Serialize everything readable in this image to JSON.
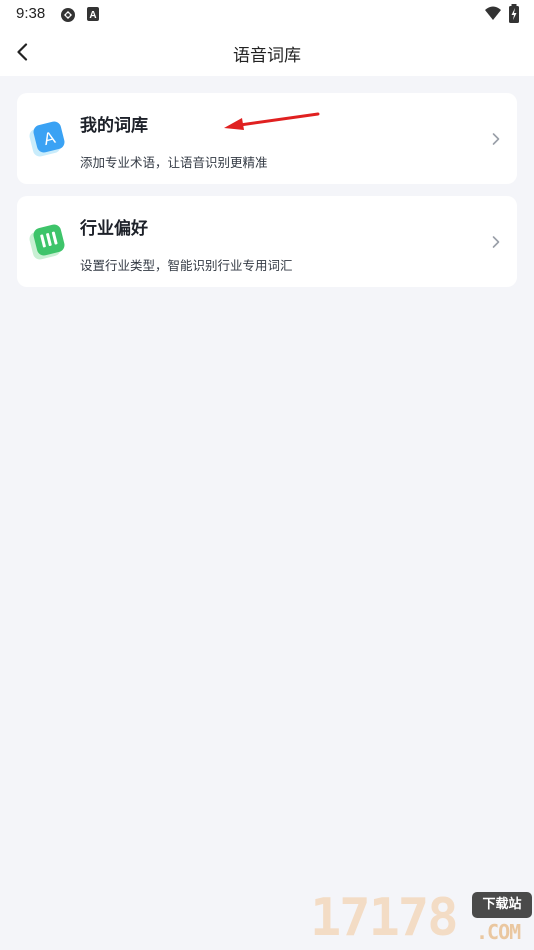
{
  "status_bar": {
    "time": "9:38",
    "icons": [
      "sync-icon",
      "a-notification-icon",
      "wifi-icon",
      "battery-charging-icon"
    ]
  },
  "nav": {
    "title": "语音词库",
    "back_icon": "back-chevron-icon"
  },
  "cards": [
    {
      "title": "我的词库",
      "desc": "添加专业术语，让语音识别更精准",
      "icon": "letter-a-icon",
      "icon_color": "#3aa2f4"
    },
    {
      "title": "行业偏好",
      "desc": "设置行业类型，智能识别行业专用词汇",
      "icon": "book-icon",
      "icon_color": "#3ec46a"
    }
  ],
  "annotation": {
    "arrow_color": "#e02020"
  },
  "watermark": {
    "digits": "17178",
    "badge": "下载站",
    "suffix": ".COM"
  }
}
